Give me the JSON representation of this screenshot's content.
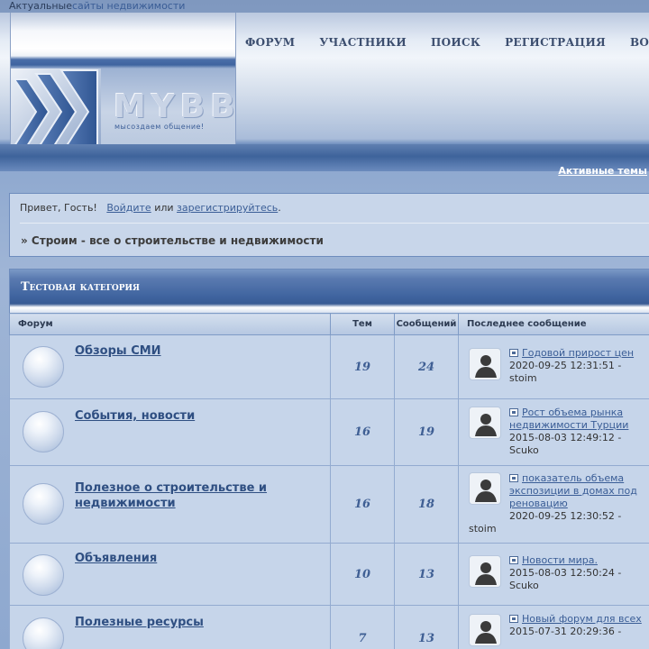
{
  "top": {
    "prefix": "Актуальные",
    "link": "сайты недвижимости"
  },
  "logo": {
    "text": "MYBB",
    "slogan": "мысоздаем общение!"
  },
  "nav": [
    "ФОРУМ",
    "УЧАСТНИКИ",
    "ПОИСК",
    "РЕГИСТРАЦИЯ",
    "ВОЙТИ"
  ],
  "active_topics": "Активные темы",
  "welcome": {
    "greeting": "Привет, Гость!",
    "login": "Войдите",
    "or": "или",
    "register": "зарегистрируйтесь",
    "dot": "."
  },
  "breadcrumb": "» Строим - все о строительстве и недвижимости",
  "category": "Тестовая категория",
  "columns": {
    "forum": "Форум",
    "topics": "Тем",
    "posts": "Сообщений",
    "last": "Последнее сообщение"
  },
  "forums": [
    {
      "name": "Обзоры СМИ",
      "topics": "19",
      "posts": "24",
      "last_title": "Годовой прирост цен",
      "last_date": "2020-09-25 12:31:51 -",
      "last_user": "stoim"
    },
    {
      "name": "События, новости",
      "topics": "16",
      "posts": "19",
      "last_title": "Рост объема рынка недвижимости Турции",
      "last_date": "2015-08-03 12:49:12 -",
      "last_user": "Scuko"
    },
    {
      "name": "Полезное о строительстве и недвижимости",
      "topics": "16",
      "posts": "18",
      "last_title": "показатель объема экспозиции в домах под реновацию",
      "last_date": "2020-09-25 12:30:52 -",
      "last_user": "stoim"
    },
    {
      "name": "Объявления",
      "topics": "10",
      "posts": "13",
      "last_title": "Новости мира.",
      "last_date": "2015-08-03 12:50:24 -",
      "last_user": "Scuko"
    },
    {
      "name": "Полезные ресурсы",
      "topics": "7",
      "posts": "13",
      "last_title": "Новый форум для всех",
      "last_date": "2015-07-31 20:29:36 -",
      "last_user": ""
    }
  ]
}
